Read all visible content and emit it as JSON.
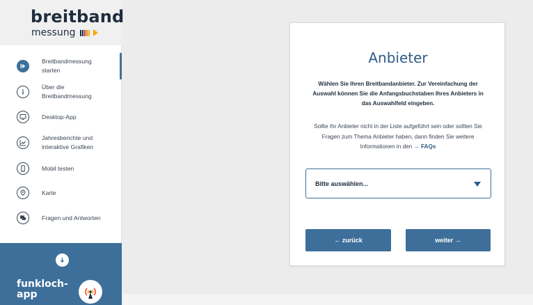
{
  "logo": {
    "main": "breitband",
    "sub": "messung"
  },
  "brand_colors": {
    "primary": "#3d6f9a",
    "accent": "#f5a800"
  },
  "sidebar": {
    "items": [
      {
        "label_line1": "Breitbandmessung",
        "label_line2": "starten",
        "icon": "play-icon",
        "active": true
      },
      {
        "label_line1": "Über die",
        "label_line2": "Breitbandmessung",
        "icon": "info-icon",
        "active": false
      },
      {
        "label_line1": "Desktop-App",
        "label_line2": "",
        "icon": "desktop-icon",
        "active": false
      },
      {
        "label_line1": "Jahresberichte und",
        "label_line2": "interaktive Grafiken",
        "icon": "chart-icon",
        "active": false
      },
      {
        "label_line1": "Mobil testen",
        "label_line2": "",
        "icon": "mobile-icon",
        "active": false
      },
      {
        "label_line1": "Karte",
        "label_line2": "",
        "icon": "map-pin-icon",
        "active": false
      },
      {
        "label_line1": "Fragen und Antworten",
        "label_line2": "",
        "icon": "chat-icon",
        "active": false
      }
    ],
    "funkloch": {
      "line1": "funkloch-",
      "line2": "app"
    }
  },
  "card": {
    "title": "Anbieter",
    "lead": "Wählen Sie Ihren Breitbandanbieter. Zur Vereinfachung der Auswahl können Sie die Anfangsbuchstaben Ihres Anbieters in das Auswahlfeld eingeben.",
    "info": "Sollte Ihr Anbieter nicht in der Liste aufgeführt sein oder sollten Sie Fragen zum Thema Anbieter haben, dann finden Sie weitere Informationen in den",
    "faq_link": "→ FAQs",
    "select_value": "Bitte auswählen...",
    "back_label": "← zurück",
    "next_label": "weiter →"
  }
}
